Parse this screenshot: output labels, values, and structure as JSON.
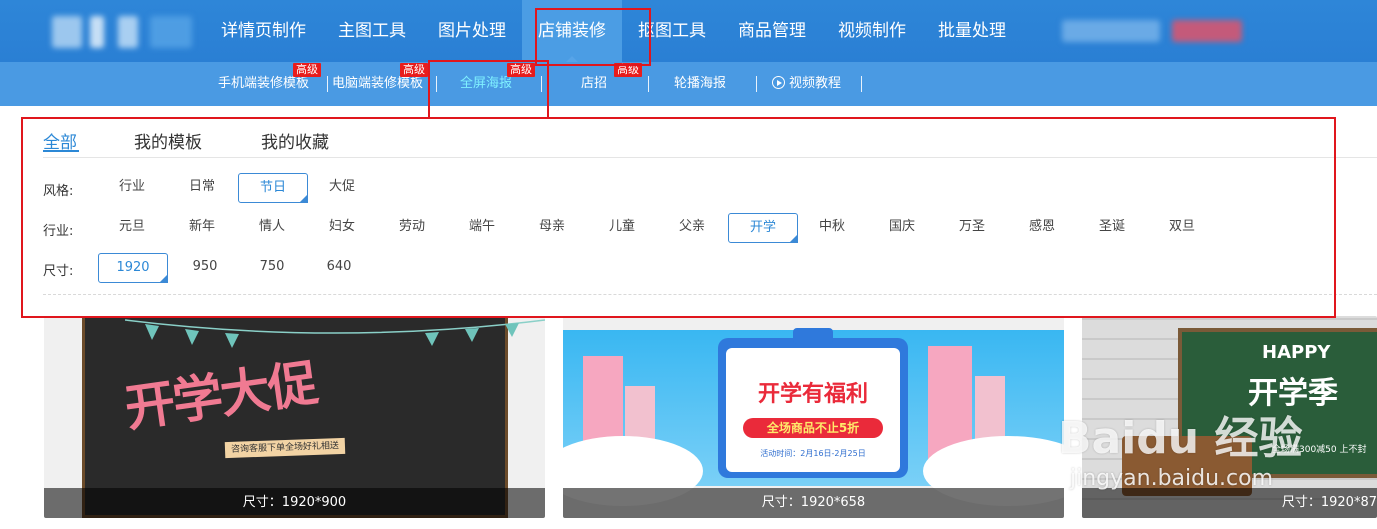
{
  "nav": {
    "items": [
      {
        "label": "详情页制作"
      },
      {
        "label": "主图工具"
      },
      {
        "label": "图片处理"
      },
      {
        "label": "店铺装修"
      },
      {
        "label": "抠图工具"
      },
      {
        "label": "商品管理"
      },
      {
        "label": "视频制作"
      },
      {
        "label": "批量处理"
      }
    ],
    "active_index": 3
  },
  "subnav": {
    "items": [
      {
        "label": "手机端装修模板",
        "badge": "高级"
      },
      {
        "label": "电脑端装修模板",
        "badge": "高级"
      },
      {
        "label": "全屏海报",
        "badge": "高级"
      },
      {
        "label": "店招",
        "badge": "高级"
      },
      {
        "label": "轮播海报"
      },
      {
        "label": "视频教程",
        "icon": "play-circle-icon"
      }
    ],
    "separator": "|",
    "active_index": 2
  },
  "tabs": [
    {
      "label": "全部"
    },
    {
      "label": "我的模板"
    },
    {
      "label": "我的收藏"
    }
  ],
  "filters": {
    "style": {
      "label": "风格:",
      "options": [
        "行业",
        "日常",
        "节日",
        "大促"
      ],
      "selected": "节日"
    },
    "industry": {
      "label": "行业:",
      "options": [
        "元旦",
        "新年",
        "情人",
        "妇女",
        "劳动",
        "端午",
        "母亲",
        "儿童",
        "父亲",
        "开学",
        "中秋",
        "国庆",
        "万圣",
        "感恩",
        "圣诞",
        "双旦"
      ],
      "selected": "开学"
    },
    "size": {
      "label": "尺寸:",
      "options": [
        "1920",
        "950",
        "750",
        "640"
      ],
      "selected": "1920"
    }
  },
  "cards": [
    {
      "caption": "尺寸：1920*900",
      "art_title": "开学大促",
      "art_strip": "咨询客服下单全场好礼相送"
    },
    {
      "caption": "尺寸：1920*658",
      "art_title": "开学有福利",
      "art_pill": "全场商品不止5折",
      "art_date": "活动时间：2月16日-2月25日"
    },
    {
      "caption": "尺寸：1920*87",
      "art_title": "HAPPY",
      "art_title2": "开学季",
      "art_sub": "全场满300减50 上不封"
    }
  ],
  "watermark": {
    "logo": "Baidu 经验",
    "url": "jingyan.baidu.com"
  },
  "colors": {
    "nav_bg": "#2e86d8",
    "subnav_bg": "#4a9ae3",
    "accent": "#2c88d6",
    "badge": "#e81c1c",
    "annotation_red": "#e0161d"
  }
}
